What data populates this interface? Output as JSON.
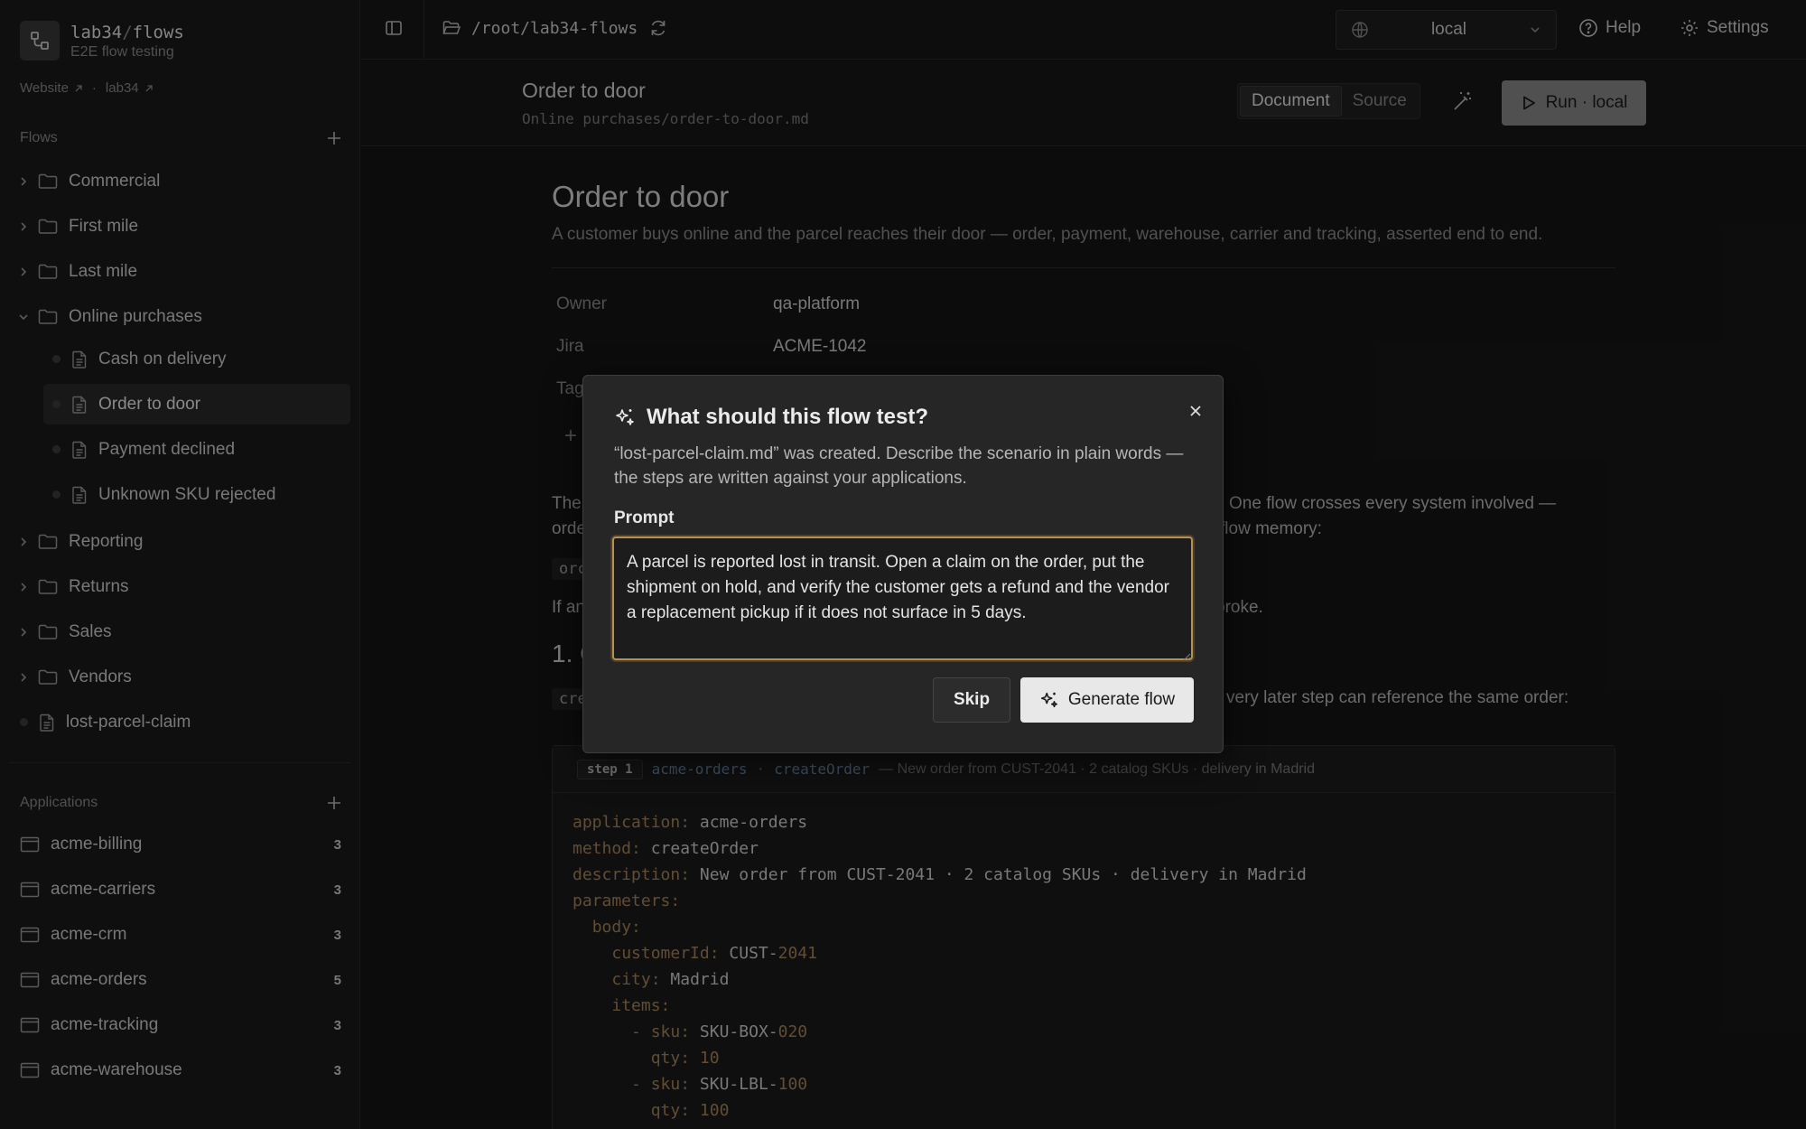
{
  "brand": {
    "name_prefix": "lab34",
    "name_sep": "/",
    "name_suffix": "flows",
    "subtitle": "E2E flow testing"
  },
  "links": [
    {
      "label": "Website"
    },
    {
      "label": "lab34"
    }
  ],
  "link_separator": "·",
  "flows_section": {
    "title": "Flows"
  },
  "flows": [
    {
      "label": "Commercial",
      "type": "folder",
      "expanded": false
    },
    {
      "label": "First mile",
      "type": "folder",
      "expanded": false
    },
    {
      "label": "Last mile",
      "type": "folder",
      "expanded": false
    },
    {
      "label": "Online purchases",
      "type": "folder",
      "expanded": true
    },
    {
      "label": "Cash on delivery",
      "type": "file"
    },
    {
      "label": "Order to door",
      "type": "file",
      "selected": true
    },
    {
      "label": "Payment declined",
      "type": "file"
    },
    {
      "label": "Unknown SKU rejected",
      "type": "file"
    },
    {
      "label": "Reporting",
      "type": "folder",
      "expanded": false
    },
    {
      "label": "Returns",
      "type": "folder",
      "expanded": false
    },
    {
      "label": "Sales",
      "type": "folder",
      "expanded": false
    },
    {
      "label": "Vendors",
      "type": "folder",
      "expanded": false
    },
    {
      "label": "lost-parcel-claim",
      "type": "file"
    }
  ],
  "applications_section": {
    "title": "Applications"
  },
  "applications": [
    {
      "label": "acme-billing",
      "count": "3"
    },
    {
      "label": "acme-carriers",
      "count": "3"
    },
    {
      "label": "acme-crm",
      "count": "3"
    },
    {
      "label": "acme-orders",
      "count": "5"
    },
    {
      "label": "acme-tracking",
      "count": "3"
    },
    {
      "label": "acme-warehouse",
      "count": "3"
    }
  ],
  "topbar": {
    "path": "/root/lab34-flows",
    "env": "local",
    "help": "Help",
    "settings": "Settings"
  },
  "doc_header": {
    "title": "Order to door",
    "path": "Online purchases/order-to-door.md",
    "view_document": "Document",
    "view_source": "Source",
    "run_label": "Run · local"
  },
  "doc": {
    "title": "Order to door",
    "description": "A customer buys online and the parcel reaches their door — order, payment, warehouse, carrier and tracking, asserted end to end.",
    "meta": [
      {
        "key": "Owner",
        "value": "qa-platform"
      },
      {
        "key": "Jira",
        "value": "ACME-1042"
      },
      {
        "key": "Tag",
        "value": ""
      }
    ],
    "add_tag": "+",
    "para1_left": "The",
    "para1_right": "One flow crosses every system involved —",
    "para1b_left": "orde",
    "para1b_right": "flow memory:",
    "chip1": "orc",
    "para2_left": "If an",
    "para2_right": "broke.",
    "h2": "1. C",
    "chip2": "cre",
    "para3_right": "very later step can reference the same order:"
  },
  "step": {
    "badge": "step 1",
    "app": "acme-orders",
    "method": "createOrder",
    "separator": "·",
    "description": "— New order from CUST-2041 · 2 catalog SKUs · delivery in Madrid",
    "code": {
      "application_key": "application:",
      "application_val": "acme-orders",
      "method_key": "method:",
      "method_val": "createOrder",
      "description_key": "description:",
      "description_val": "New order from CUST-2041 · 2 catalog SKUs · delivery in Madrid",
      "parameters_key": "parameters:",
      "body_key": "body:",
      "customer_key": "customerId:",
      "customer_val": "CUST-",
      "customer_num": "2041",
      "city_key": "city:",
      "city_val": "Madrid",
      "items_key": "items:",
      "dash": "-",
      "sku_key": "sku:",
      "qty_key": "qty:",
      "sku1_val": "SKU-BOX-",
      "sku1_num": "020",
      "qty1_num": "10",
      "sku2_val": "SKU-LBL-",
      "sku2_num": "100",
      "qty2_num": "100"
    }
  },
  "dialog": {
    "title": "What should this flow test?",
    "description": "“lost-parcel-claim.md” was created. Describe the scenario in plain words — the steps are written against your applications.",
    "prompt_label": "Prompt",
    "prompt_value": "A parcel is reported lost in transit. Open a claim on the order, put the shipment on hold, and verify the customer gets a refund and the vendor a replacement pickup if it does not surface in 5 days.",
    "skip": "Skip",
    "generate": "Generate flow"
  },
  "colors": {
    "accent_focus": "#b8904f",
    "run_button": "#8a8a8a",
    "code_key": "#a8855a",
    "code_app": "#6f8fb0"
  }
}
